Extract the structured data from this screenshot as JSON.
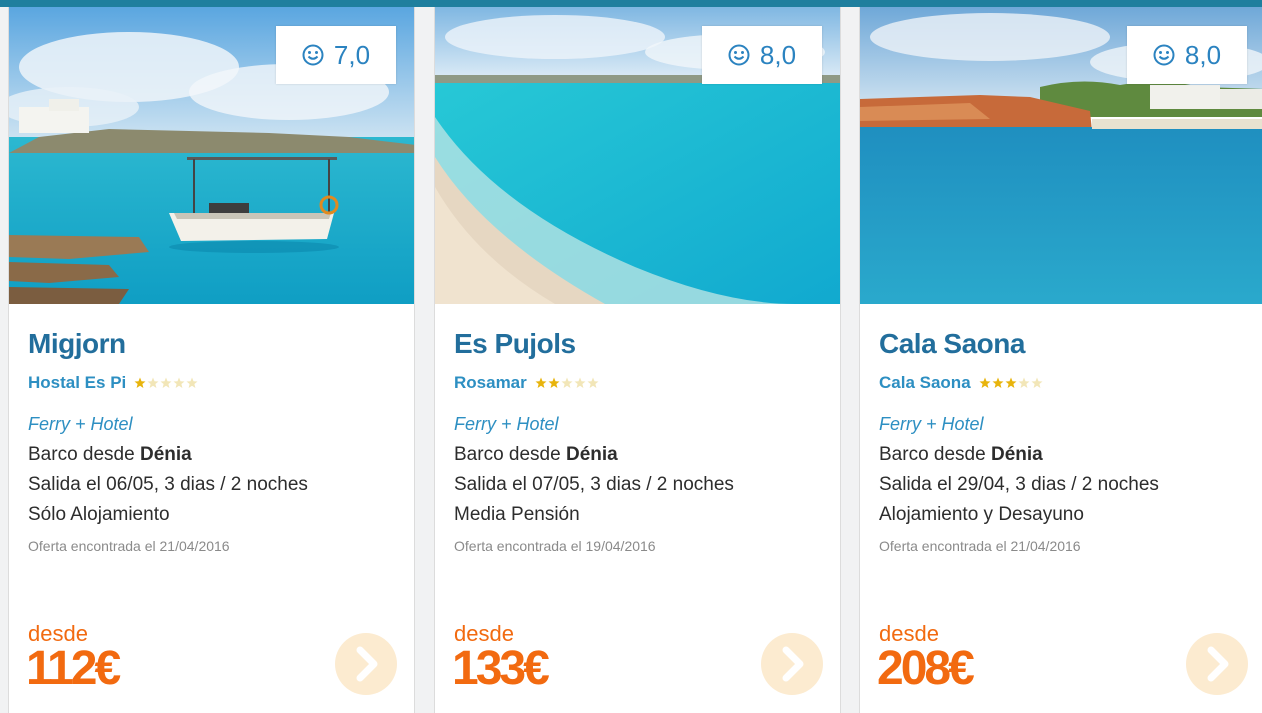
{
  "colors": {
    "accent": "#2d8fc2",
    "title": "#226e9c",
    "price": "#f26a10",
    "bar": "#1f7f9e"
  },
  "cards": [
    {
      "rating": "7,0",
      "destination": "Migjorn",
      "hotel": "Hostal Es Pi",
      "stars": 1,
      "package_type": "Ferry + Hotel",
      "departure_prefix": "Barco desde ",
      "departure_city": "Dénia",
      "dates": "Salida el 06/05, 3 dias / 2 noches",
      "board": "Sólo Alojamiento",
      "found": "Oferta encontrada el 21/04/2016",
      "from_label": "desde",
      "price": "112€"
    },
    {
      "rating": "8,0",
      "destination": "Es Pujols",
      "hotel": "Rosamar",
      "stars": 2,
      "package_type": "Ferry + Hotel",
      "departure_prefix": "Barco desde ",
      "departure_city": "Dénia",
      "dates": "Salida el 07/05, 3 dias / 2 noches",
      "board": "Media Pensión",
      "found": "Oferta encontrada el 19/04/2016",
      "from_label": "desde",
      "price": "133€"
    },
    {
      "rating": "8,0",
      "destination": "Cala Saona",
      "hotel": "Cala Saona",
      "stars": 3,
      "package_type": "Ferry + Hotel",
      "departure_prefix": "Barco desde ",
      "departure_city": "Dénia",
      "dates": "Salida el 29/04, 3 dias / 2 noches",
      "board": "Alojamiento y Desayuno",
      "found": "Oferta encontrada el 21/04/2016",
      "from_label": "desde",
      "price": "208€"
    }
  ]
}
